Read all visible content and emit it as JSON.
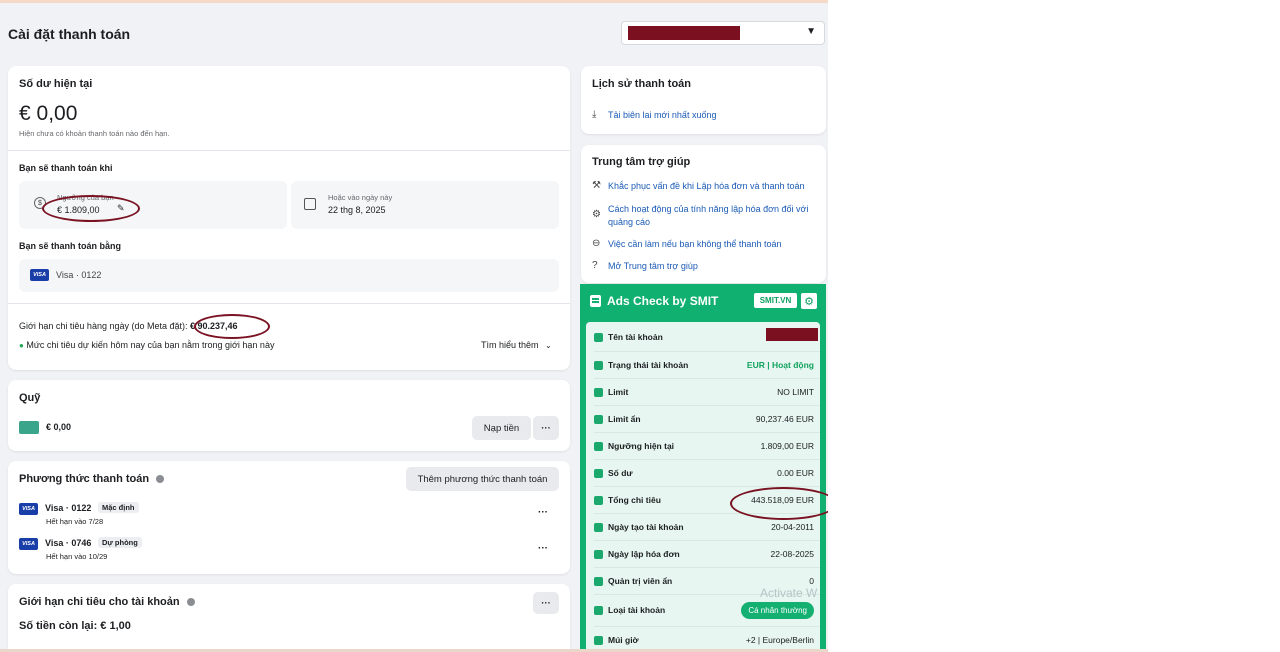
{
  "page": {
    "title": "Cài đặt thanh toán"
  },
  "balance": {
    "title": "Số dư hiện tại",
    "amount": "€ 0,00",
    "note": "Hiện chưa có khoản thanh toán nào đến hạn.",
    "pay_when_title": "Bạn sẽ thanh toán khi",
    "threshold_label": "Ngưỡng của bạn",
    "threshold_value": "€ 1.809,00",
    "date_label": "Hoặc vào ngày này",
    "date_value": "22 thg 8, 2025",
    "pay_with_title": "Bạn sẽ thanh toán bằng",
    "card": "Visa · 0122",
    "daily_limit_label": "Giới hạn chi tiêu hàng ngày (do Meta đặt):",
    "daily_limit_value": "€ 90.237,46",
    "daily_limit_note": "Mức chi tiêu dự kiến hôm nay của bạn nằm trong giới hạn này",
    "learn_more": "Tìm hiểu thêm"
  },
  "fund": {
    "title": "Quỹ",
    "amount": "€ 0,00",
    "add_funds": "Nạp tiền",
    "more": "···"
  },
  "payment_methods": {
    "title": "Phương thức thanh toán",
    "add_button": "Thêm phương thức thanh toán",
    "items": [
      {
        "name": "Visa · 0122",
        "tag": "Mặc định",
        "expiry": "Hết hạn vào 7/28"
      },
      {
        "name": "Visa · 0746",
        "tag": "Dự phòng",
        "expiry": "Hết hạn vào 10/29"
      }
    ],
    "more": "···"
  },
  "account_limit": {
    "title": "Giới hạn chi tiêu cho tài khoản",
    "remaining": "Số tiền còn lại: € 1,00",
    "more": "···"
  },
  "history": {
    "title": "Lịch sử thanh toán",
    "download": "Tải biên lai mới nhất xuống"
  },
  "help": {
    "title": "Trung tâm trợ giúp",
    "links": [
      "Khắc phục vấn đề khi Lập hóa đơn và thanh toán",
      "Cách hoạt động của tính năng lập hóa đơn đối với quảng cáo",
      "Việc cần làm nếu bạn không thể thanh toán",
      "Mở Trung tâm trợ giúp"
    ]
  },
  "smit": {
    "title": "Ads Check by SMIT",
    "badge": "SMIT.VN",
    "rows": [
      {
        "label": "Tên tài khoản",
        "value": ""
      },
      {
        "label": "Trạng thái tài khoản",
        "value": "EUR | Hoạt động"
      },
      {
        "label": "Limit",
        "value": "NO LIMIT"
      },
      {
        "label": "Limit ẩn",
        "value": "90,237.46 EUR"
      },
      {
        "label": "Ngưỡng hiện tại",
        "value": "1.809,00 EUR"
      },
      {
        "label": "Số dư",
        "value": "0.00 EUR"
      },
      {
        "label": "Tổng chi tiêu",
        "value": "443.518,09 EUR"
      },
      {
        "label": "Ngày tạo tài khoản",
        "value": "20-04-2011"
      },
      {
        "label": "Ngày lập hóa đơn",
        "value": "22-08-2025"
      },
      {
        "label": "Quản trị viên ẩn",
        "value": "0"
      },
      {
        "label": "Loại tài khoản",
        "value": "Cá nhân thường"
      },
      {
        "label": "Múi giờ",
        "value": "+2 | Europe/Berlin"
      }
    ]
  },
  "watermark": "Activate W",
  "colors": {
    "accent_green": "#10b070",
    "annotation": "#7a1222",
    "link": "#1b5bb5"
  }
}
